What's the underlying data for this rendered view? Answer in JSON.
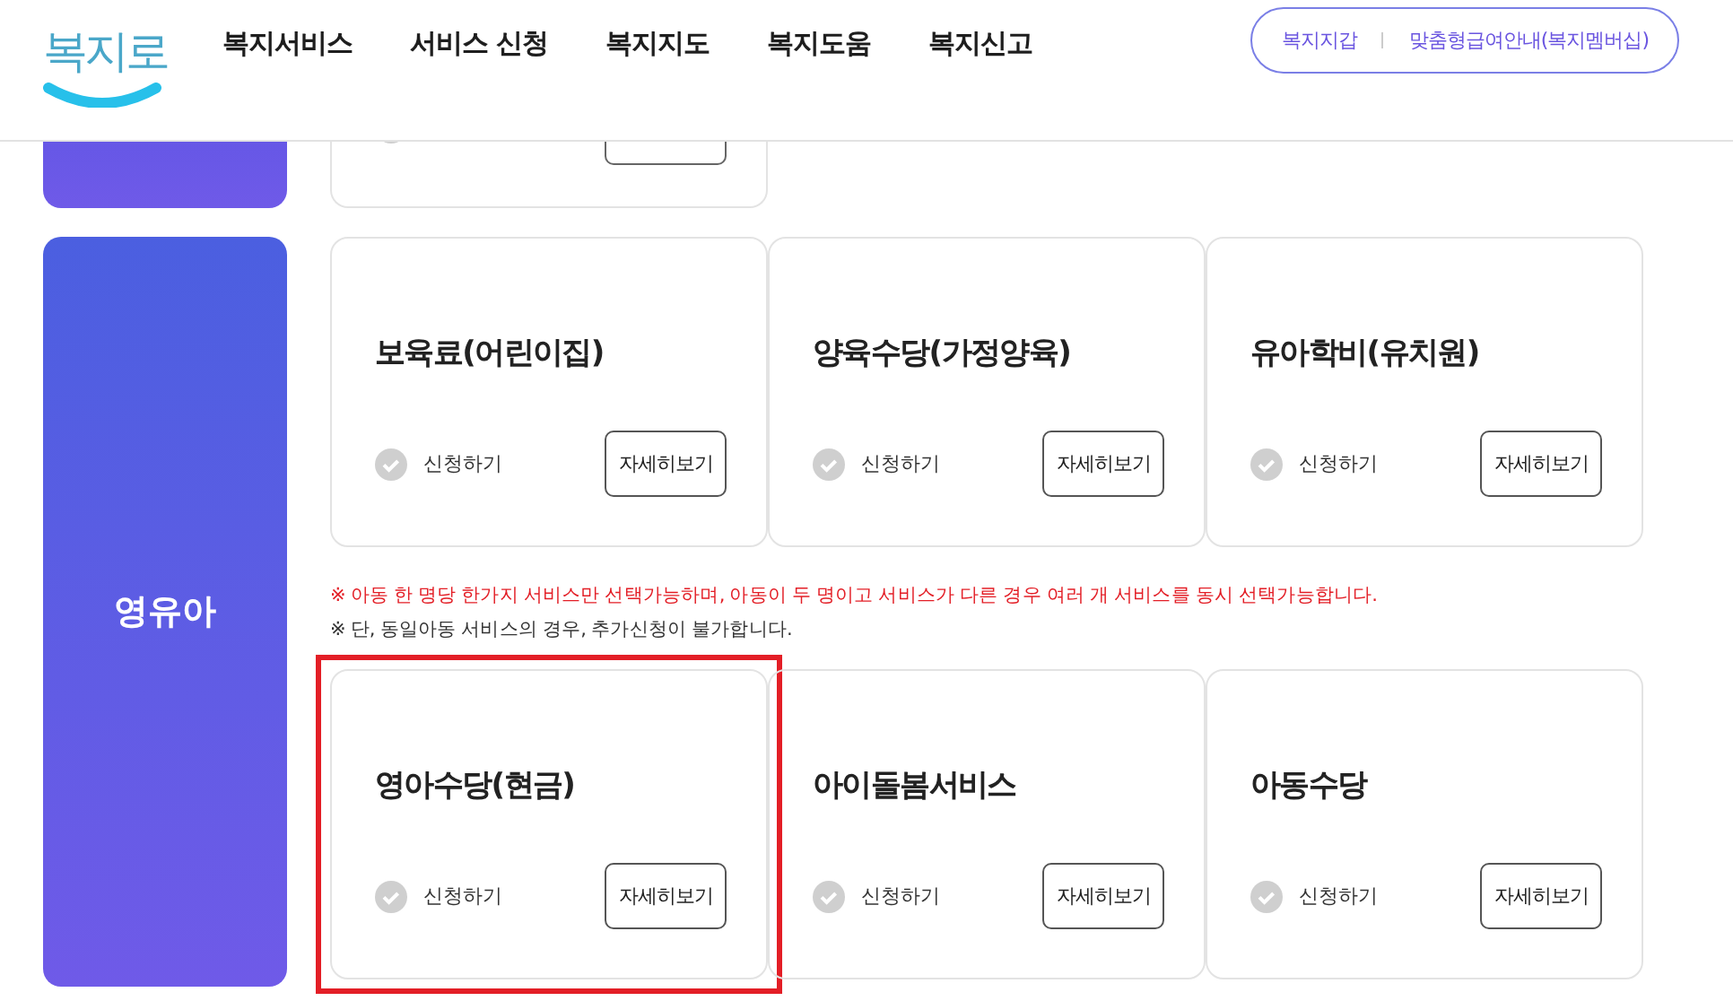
{
  "header": {
    "logo": "복지로",
    "nav": [
      "복지서비스",
      "서비스 신청",
      "복지지도",
      "복지도움",
      "복지신고"
    ],
    "quick_links": [
      "복지지갑",
      "맞춤형급여안내(복지멤버십)"
    ]
  },
  "category": {
    "label": "영유아"
  },
  "cards_top": [
    {
      "title": "보육료(어린이집)",
      "apply": "신청하기",
      "detail": "자세히보기",
      "highlighted": false
    },
    {
      "title": "양육수당(가정양육)",
      "apply": "신청하기",
      "detail": "자세히보기",
      "highlighted": false
    },
    {
      "title": "유아학비(유치원)",
      "apply": "신청하기",
      "detail": "자세히보기",
      "highlighted": false
    }
  ],
  "notes": [
    {
      "text": "※ 아동 한 명당 한가지 서비스만 선택가능하며, 아동이 두 명이고 서비스가 다른 경우 여러 개 서비스를 동시 선택가능합니다.",
      "kind": "warning"
    },
    {
      "text": "※ 단, 동일아동 서비스의 경우, 추가신청이 불가합니다.",
      "kind": "info"
    }
  ],
  "cards_bottom": [
    {
      "title": "영아수당(현금)",
      "apply": "신청하기",
      "detail": "자세히보기",
      "highlighted": true
    },
    {
      "title": "아이돌봄서비스",
      "apply": "신청하기",
      "detail": "자세히보기",
      "highlighted": false
    },
    {
      "title": "아동수당",
      "apply": "신청하기",
      "detail": "자세히보기",
      "highlighted": false
    }
  ]
}
